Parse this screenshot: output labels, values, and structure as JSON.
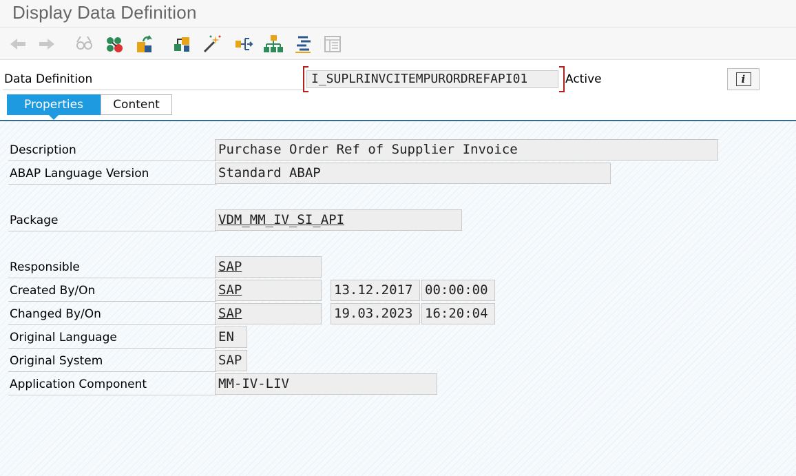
{
  "window": {
    "title": "Display Data Definition"
  },
  "toolbar": {
    "icons": [
      "back-arrow",
      "forward-arrow",
      "display-change-glasses",
      "other-object",
      "activate",
      "where-used-list",
      "magic-wand",
      "navigate",
      "hierarchy",
      "outline",
      "layout"
    ]
  },
  "header": {
    "label": "Data Definition",
    "name": "I_SUPLRINVCITEMPURORDREFAPI01",
    "status": "Active",
    "info_glyph": "i"
  },
  "tabs": [
    {
      "label": "Properties",
      "active": true
    },
    {
      "label": "Content",
      "active": false
    }
  ],
  "properties": {
    "description": {
      "label": "Description",
      "value": "Purchase Order Ref of Supplier Invoice"
    },
    "language_version": {
      "label": "ABAP Language Version",
      "value": "Standard ABAP"
    },
    "package": {
      "label": "Package",
      "value": "VDM_MM_IV_SI_API"
    },
    "responsible": {
      "label": "Responsible",
      "value": "SAP"
    },
    "created": {
      "label": "Created By/On",
      "user": "SAP",
      "date": "13.12.2017",
      "time": "00:00:00"
    },
    "changed": {
      "label": "Changed By/On",
      "user": "SAP",
      "date": "19.03.2023",
      "time": "16:20:04"
    },
    "original_language": {
      "label": "Original Language",
      "value": "EN"
    },
    "original_system": {
      "label": "Original System",
      "value": "SAP"
    },
    "application_component": {
      "label": "Application Component",
      "value": "MM-IV-LIV"
    }
  },
  "colors": {
    "active_tab": "#1d9ae0",
    "bracket": "#b21f1f",
    "tab_line": "#3a6a8c"
  }
}
